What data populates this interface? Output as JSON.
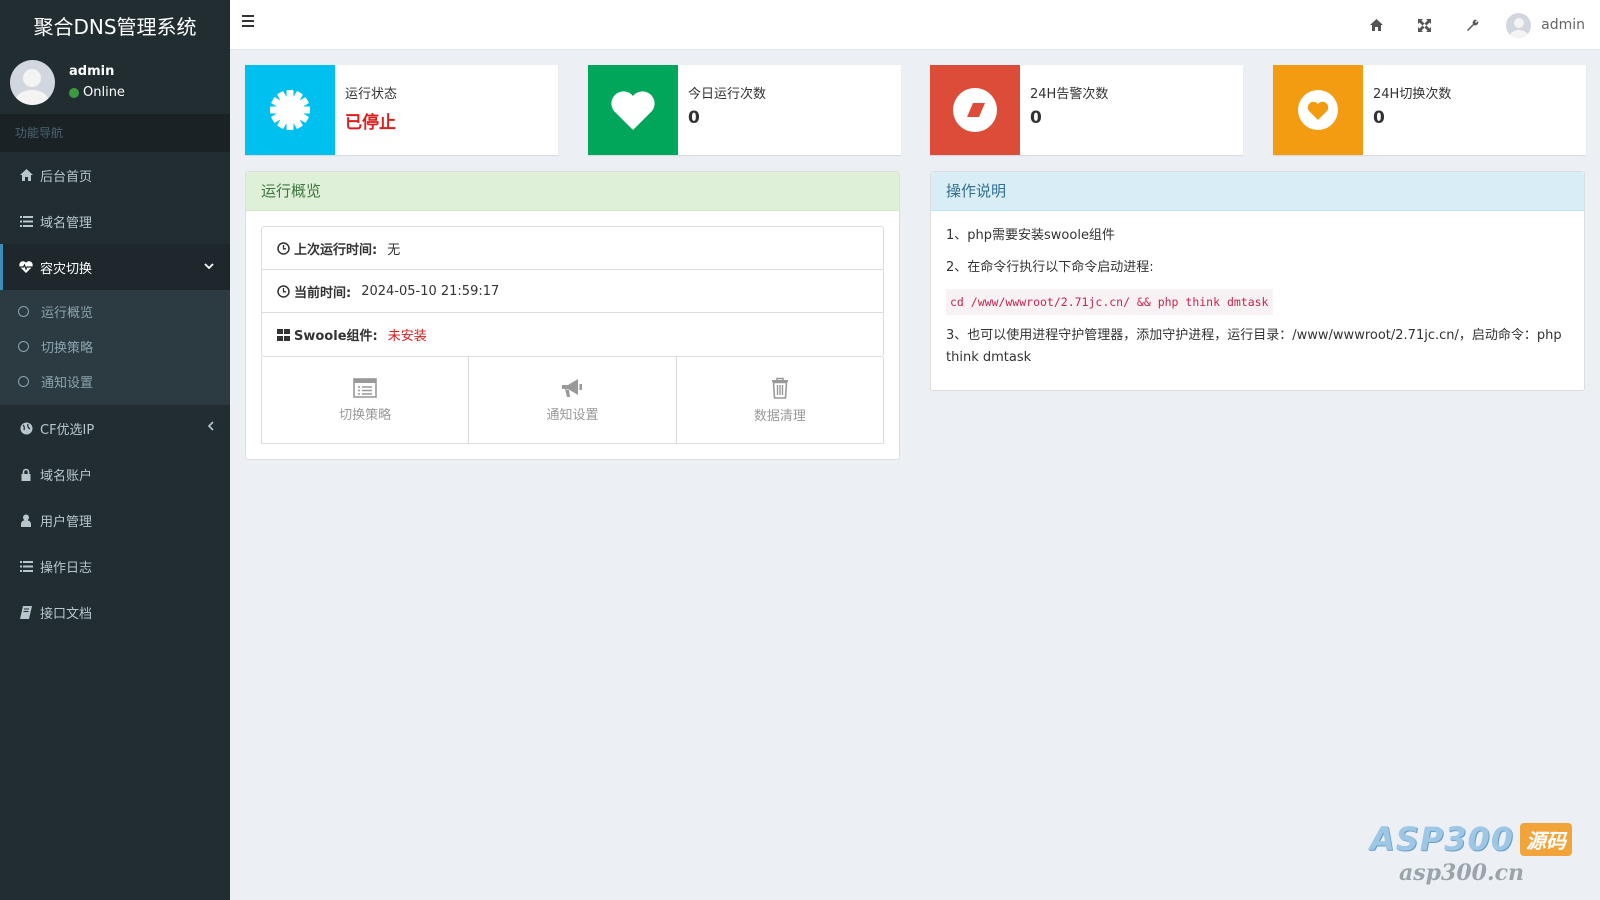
{
  "brand": {
    "title": "聚合DNS管理系统"
  },
  "user_panel": {
    "name": "admin",
    "status": "Online"
  },
  "nav": {
    "header": "功能导航",
    "items": [
      {
        "label": "后台首页",
        "icon": "home-icon"
      },
      {
        "label": "域名管理",
        "icon": "list-icon"
      },
      {
        "label": "容灾切换",
        "icon": "heartbeat-icon"
      },
      {
        "label": "CF优选IP",
        "icon": "globe-icon"
      },
      {
        "label": "域名账户",
        "icon": "lock-icon"
      },
      {
        "label": "用户管理",
        "icon": "user-icon"
      },
      {
        "label": "操作日志",
        "icon": "list-icon"
      },
      {
        "label": "接口文档",
        "icon": "book-icon"
      }
    ],
    "submenu": [
      {
        "label": "运行概览"
      },
      {
        "label": "切换策略"
      },
      {
        "label": "通知设置"
      }
    ]
  },
  "topbar": {
    "username": "admin"
  },
  "info_boxes": [
    {
      "text": "运行状态",
      "number": "已停止",
      "color": "#00c0ef",
      "icon": "gear-icon"
    },
    {
      "text": "今日运行次数",
      "number": "0",
      "color": "#00a65a",
      "icon": "heart-icon"
    },
    {
      "text": "24H告警次数",
      "number": "0",
      "color": "#dd4b39",
      "icon": "eraser-icon"
    },
    {
      "text": "24H切换次数",
      "number": "0",
      "color": "#f39c12",
      "icon": "heart-circle-icon"
    }
  ],
  "overview": {
    "title": "运行概览",
    "rows": [
      {
        "label": "上次运行时间:",
        "value": "无"
      },
      {
        "label": "当前时间:",
        "value": "2024-05-10 21:59:17"
      },
      {
        "label": "Swoole组件:",
        "value": "未安装"
      }
    ],
    "buttons": [
      {
        "label": "切换策略",
        "icon": "list-alt-icon"
      },
      {
        "label": "通知设置",
        "icon": "bullhorn-icon"
      },
      {
        "label": "数据清理",
        "icon": "trash-icon"
      }
    ]
  },
  "instructions": {
    "title": "操作说明",
    "line1": "1、php需要安装swoole组件",
    "line2": "2、在命令行执行以下命令启动进程:",
    "code": "cd /www/wwwroot/2.71jc.cn/ && php think dmtask",
    "line3": "3、也可以使用进程守护管理器，添加守护进程，运行目录：/www/wwwroot/2.71jc.cn/，启动命令：php think dmtask"
  },
  "watermark": {
    "brand": "ASP300",
    "tag": "源码",
    "domain": "asp300.cn"
  }
}
